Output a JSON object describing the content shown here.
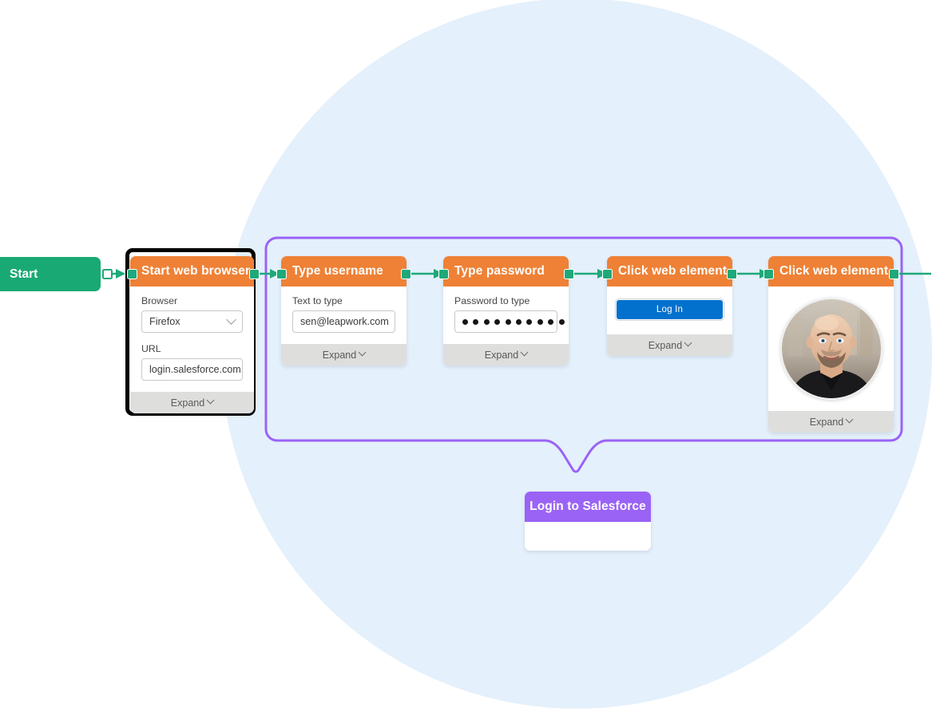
{
  "canvas": {
    "background_color": "#ffffff",
    "circle_color": "#e4f0fb",
    "accent_orange": "#ee8136",
    "accent_green": "#19a974",
    "accent_purple": "#9a63f5",
    "salesforce_blue": "#0271ce"
  },
  "start_node": {
    "label": "Start"
  },
  "group": {
    "label": "Login to Salesforce",
    "border_color": "#9a63f5"
  },
  "nodes": [
    {
      "title": "Start web browser",
      "selected": true,
      "fields": [
        {
          "label": "Browser",
          "type": "select",
          "value": "Firefox"
        },
        {
          "label": "URL",
          "type": "text",
          "value": "login.salesforce.com"
        }
      ],
      "footer": "Expand"
    },
    {
      "title": "Type username",
      "selected": false,
      "fields": [
        {
          "label": "Text to type",
          "type": "text",
          "value": "sen@leapwork.com"
        }
      ],
      "footer": "Expand"
    },
    {
      "title": "Type password",
      "selected": false,
      "fields": [
        {
          "label": "Password to type",
          "type": "password",
          "value": "•••••••••••••",
          "dot_count": 13
        }
      ],
      "footer": "Expand"
    },
    {
      "title": "Click web element",
      "selected": false,
      "fields": [
        {
          "label": "",
          "type": "button",
          "value": "Log In"
        }
      ],
      "footer": "Expand"
    },
    {
      "title": "Click web element",
      "selected": false,
      "fields": [
        {
          "label": "",
          "type": "avatar",
          "value": "user-avatar-photo"
        }
      ],
      "footer": "Expand"
    }
  ],
  "subflow_node": {
    "title": "Login to Salesforce"
  },
  "icons": {
    "chevron_down": "chevron-down-icon",
    "select_chevron": "chevron-down-icon"
  }
}
